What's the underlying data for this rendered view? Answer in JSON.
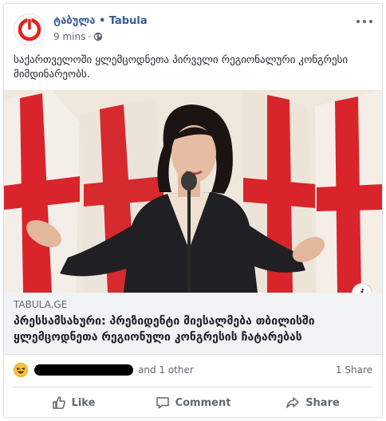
{
  "post": {
    "page_name": "ტაბულა • Tabula",
    "time": "9 mins",
    "separator": "·",
    "privacy_icon": "globe-icon",
    "text": "საქართველოში ყლემცოდნეთა პირველი რეგიონალური კონგრესი მიმდინარეობს."
  },
  "link": {
    "domain": "TABULA.GE",
    "title": "პრესსამსახური: პრეზიდენტი მიესალმება თბილისში ყლემცოდნეთა რეგიონული კონგრესის ჩატარებას",
    "info_icon_text": "i"
  },
  "reactions": {
    "emoji": "haha-icon",
    "others": "and 1 other",
    "shares": "1 Share"
  },
  "actions": {
    "like": "Like",
    "comment": "Comment",
    "share": "Share"
  },
  "colors": {
    "brand_red": "#e2231a",
    "link_blue": "#365899",
    "flag_red": "#d9242b"
  }
}
